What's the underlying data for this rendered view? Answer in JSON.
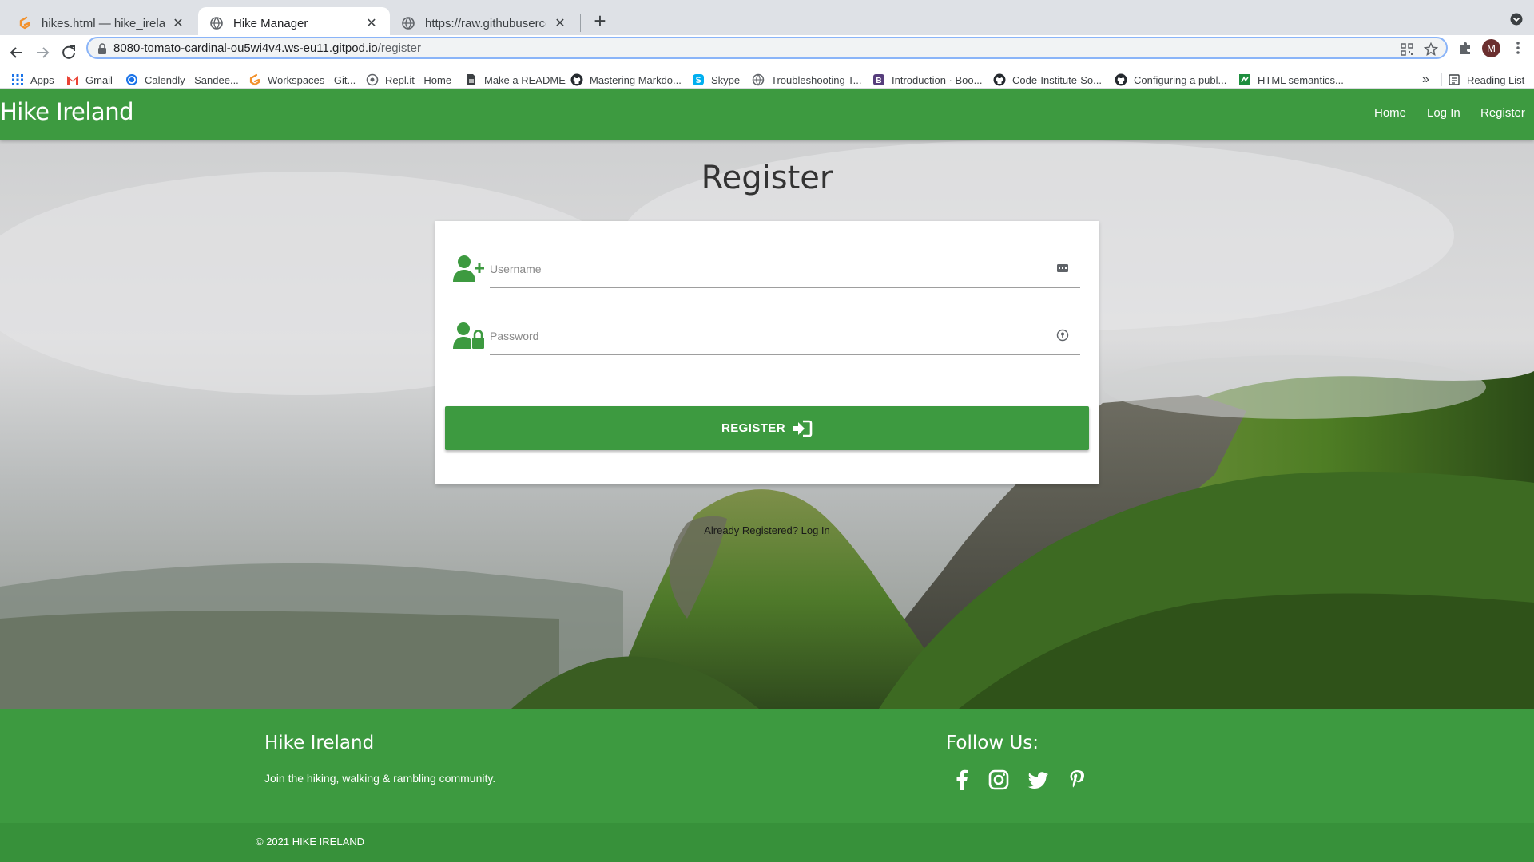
{
  "browser": {
    "tabs": [
      {
        "title": "hikes.html — hike_ireland — Gi",
        "favicon": "gitpod-icon"
      },
      {
        "title": "Hike Manager",
        "favicon": "globe-icon"
      },
      {
        "title": "https://raw.githubusercontent.c",
        "favicon": "globe-icon"
      }
    ],
    "url_host": "8080-tomato-cardinal-ou5wi4v4.ws-eu11.gitpod.io",
    "url_path": "/register",
    "profile_initial": "M",
    "bookmarks": [
      {
        "label": "Apps",
        "icon": "apps-grid-icon"
      },
      {
        "label": "Gmail",
        "icon": "gmail-icon"
      },
      {
        "label": "Calendly - Sandee...",
        "icon": "calendly-icon"
      },
      {
        "label": "Workspaces - Git...",
        "icon": "gitpod-icon"
      },
      {
        "label": "Repl.it - Home",
        "icon": "replit-icon"
      },
      {
        "label": "Make a README",
        "icon": "document-icon"
      },
      {
        "label": "Mastering Markdo...",
        "icon": "github-icon"
      },
      {
        "label": "Skype",
        "icon": "skype-icon"
      },
      {
        "label": "Troubleshooting T...",
        "icon": "globe-icon"
      },
      {
        "label": "Introduction · Boo...",
        "icon": "bootstrap-icon"
      },
      {
        "label": "Code-Institute-So...",
        "icon": "github-icon"
      },
      {
        "label": "Configuring a publ...",
        "icon": "github-icon"
      },
      {
        "label": "HTML semantics...",
        "icon": "html-icon"
      }
    ],
    "more_bookmarks": "»",
    "reading_list": "Reading List"
  },
  "site": {
    "brand": "Hike Ireland",
    "nav": {
      "home": "Home",
      "login": "Log In",
      "register": "Register"
    },
    "colors": {
      "primary": "#3d9a40",
      "footer_bottom": "#37913a"
    }
  },
  "form": {
    "title": "Register",
    "username_placeholder": "Username",
    "password_placeholder": "Password",
    "submit_label": "REGISTER",
    "already_text": "Already Registered?",
    "login_link": "Log In"
  },
  "footer": {
    "title": "Hike Ireland",
    "tagline": "Join the hiking, walking & rambling community.",
    "follow_title": "Follow Us:",
    "social": [
      "facebook-icon",
      "instagram-icon",
      "twitter-icon",
      "pinterest-icon"
    ],
    "copyright": "© 2021 HIKE IRELAND"
  }
}
